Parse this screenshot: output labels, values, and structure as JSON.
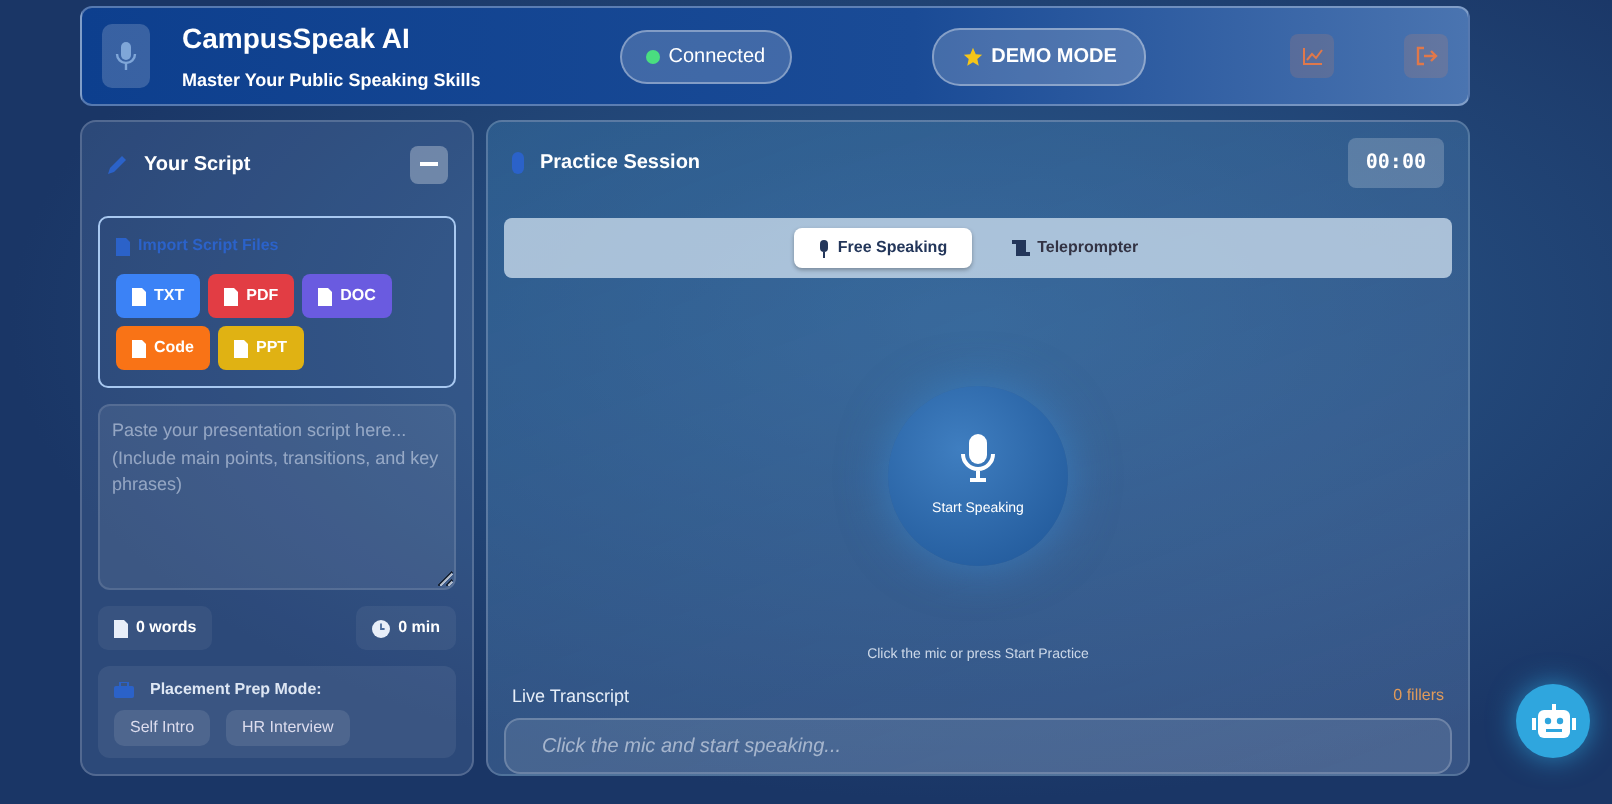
{
  "header": {
    "title": "CampusSpeak AI",
    "subtitle": "Master Your Public Speaking Skills",
    "status": {
      "label": "Connected",
      "connected": true
    },
    "demo_badge": "DEMO MODE"
  },
  "script_panel": {
    "title": "Your Script",
    "import": {
      "title": "Import Script Files",
      "buttons": [
        {
          "label": "TXT",
          "color": "#3b82f6"
        },
        {
          "label": "PDF",
          "color": "#e23d44"
        },
        {
          "label": "DOC",
          "color": "#6a5be0"
        },
        {
          "label": "Code",
          "color": "#f97316"
        },
        {
          "label": "PPT",
          "color": "#e0b213"
        }
      ]
    },
    "editor": {
      "placeholder": "Paste your presentation script here...\n(Include main points, transitions, and key phrases)"
    },
    "word_count": "0 words",
    "duration": "0 min",
    "placement": {
      "title": "Placement Prep Mode:",
      "options": [
        {
          "label": "Self Intro",
          "selected": false
        },
        {
          "label": "HR Interview",
          "selected": false
        }
      ]
    }
  },
  "practice": {
    "title": "Practice Session",
    "timer": "00:00",
    "tabs": [
      {
        "label": "Free Speaking",
        "selected": true,
        "kind": "mic"
      },
      {
        "label": "Teleprompter",
        "selected": false,
        "kind": "scroll"
      }
    ],
    "mic_label": "Start Speaking",
    "hint": "Click the mic or press Start Practice",
    "transcript": {
      "label": "Live Transcript",
      "fillers": "0 fillers",
      "placeholder": "Click the mic and start speaking..."
    }
  }
}
